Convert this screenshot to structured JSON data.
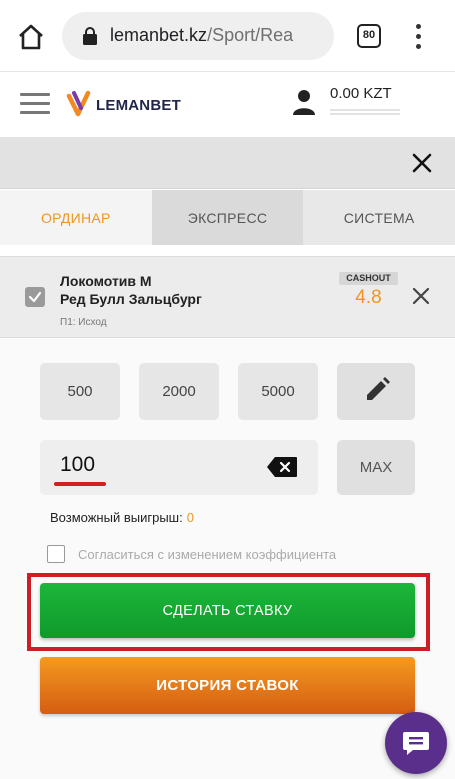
{
  "browser": {
    "url_host": "lemanbet.kz",
    "url_path": "/Sport/Rea",
    "tab_count": "80"
  },
  "header": {
    "logo_text": "LEMANBET",
    "balance": "0.00 KZT"
  },
  "tabs": [
    {
      "label": "ОРДИНАР",
      "active": true
    },
    {
      "label": "ЭКСПРЕСС",
      "active": false
    },
    {
      "label": "СИСТЕМА",
      "active": false
    }
  ],
  "bet": {
    "team1": "Локомотив М",
    "team2": "Ред Булл Зальцбург",
    "market": "П1: Исход",
    "cashout_label": "CASHOUT",
    "odd": "4.8"
  },
  "quick_stakes": [
    "500",
    "2000",
    "5000"
  ],
  "stake": {
    "value": "100",
    "max_label": "MAX"
  },
  "possible_win": {
    "label": "Возможный выигрыш:",
    "value": "0"
  },
  "agree_label": "Согласиться с изменением коэффициента",
  "buttons": {
    "make_bet": "СДЕЛАТЬ СТАВКУ",
    "history": "ИСТОРИЯ СТАВОК"
  },
  "colors": {
    "accent_orange": "#f0951f",
    "make_bet_green": "#1db63a",
    "highlight_red": "#d01c24",
    "chat_purple": "#5a2f8c"
  }
}
